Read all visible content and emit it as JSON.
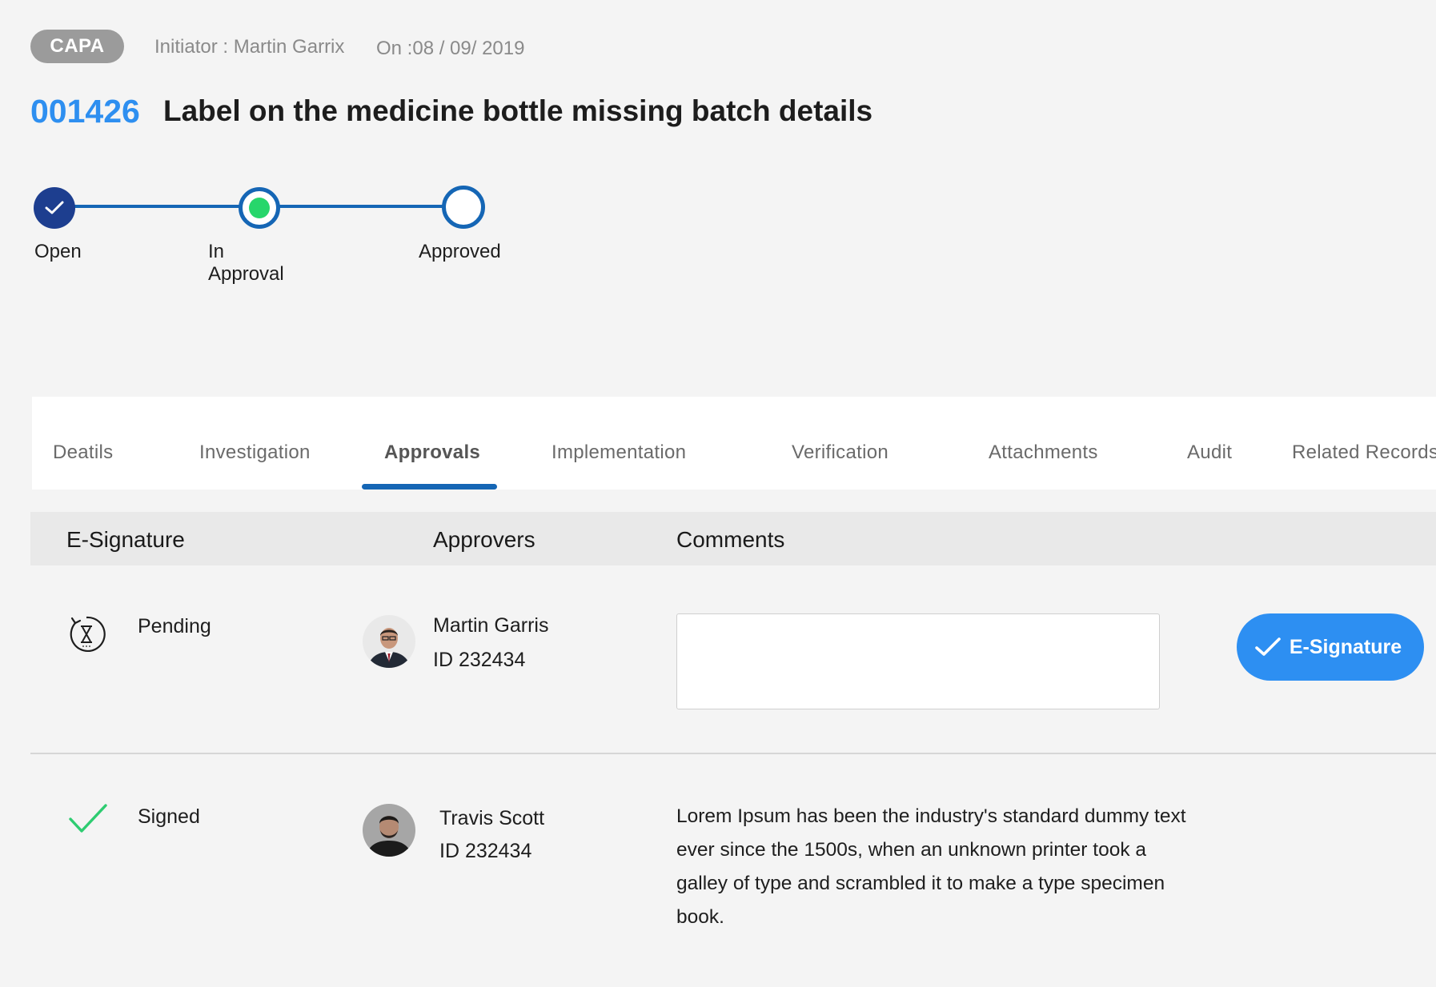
{
  "header": {
    "badge": "CAPA",
    "initiator": "Initiator : Martin Garrix",
    "date": "On :08 / 09/ 2019",
    "record_id": "001426",
    "title": "Label on the medicine bottle missing batch details"
  },
  "stepper": {
    "steps": [
      {
        "label": "Open",
        "state": "done"
      },
      {
        "label": "In Approval",
        "state": "current"
      },
      {
        "label": "Approved",
        "state": "pending"
      }
    ],
    "colors": {
      "done": "#1d3e8f",
      "line": "#1566b5",
      "current_dot": "#27d66b"
    }
  },
  "tabs": [
    {
      "label": "Deatils"
    },
    {
      "label": "Investigation"
    },
    {
      "label": "Approvals",
      "active": true
    },
    {
      "label": "Implementation"
    },
    {
      "label": "Verification"
    },
    {
      "label": "Attachments"
    },
    {
      "label": "Audit"
    },
    {
      "label": "Related Records"
    }
  ],
  "table": {
    "headers": {
      "esignature": "E-Signature",
      "approvers": "Approvers",
      "comments": "Comments"
    },
    "rows": [
      {
        "status": "Pending",
        "status_icon": "hourglass-refresh-icon",
        "approver_name": "Martin Garris",
        "approver_id": "ID 232434",
        "comment": "",
        "action_label": "E-Signature"
      },
      {
        "status": "Signed",
        "status_icon": "checkmark-icon",
        "approver_name": "Travis Scott",
        "approver_id": "ID 232434",
        "comment": "Lorem Ipsum has been the industry's standard dummy text ever since the 1500s, when an unknown printer took a galley of type and scrambled it to make a type specimen book."
      }
    ]
  },
  "colors": {
    "accent": "#2d8ff2",
    "signed_green": "#2ecc71"
  }
}
